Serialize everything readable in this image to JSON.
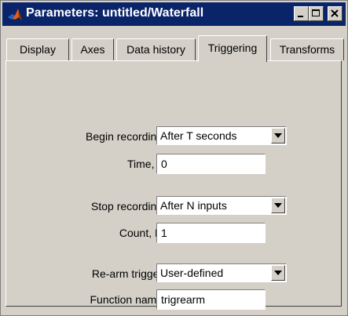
{
  "window": {
    "title": "Parameters: untitled/Waterfall",
    "icon": "matlab-icon",
    "controls": [
      "minimize-icon",
      "maximize-icon",
      "close-icon"
    ]
  },
  "tabs": [
    {
      "label": "Display"
    },
    {
      "label": "Axes"
    },
    {
      "label": "Data history"
    },
    {
      "label": "Triggering"
    },
    {
      "label": "Transforms"
    }
  ],
  "active_tab": "Triggering",
  "form": {
    "begin_recording": {
      "label": "Begin recording:",
      "value": "After T seconds"
    },
    "time": {
      "label": "Time, T:",
      "value": "0"
    },
    "stop_recording": {
      "label": "Stop recording:",
      "value": "After N inputs"
    },
    "count": {
      "label": "Count, N:",
      "value": "1"
    },
    "rearm_trigger": {
      "label": "Re-arm trigger:",
      "value": "User-defined"
    },
    "function_name": {
      "label": "Function name:",
      "value": "trigrearm"
    }
  },
  "colors": {
    "title_bar": "#0a246a",
    "face": "#d4d0c8",
    "field": "#ffffff"
  }
}
